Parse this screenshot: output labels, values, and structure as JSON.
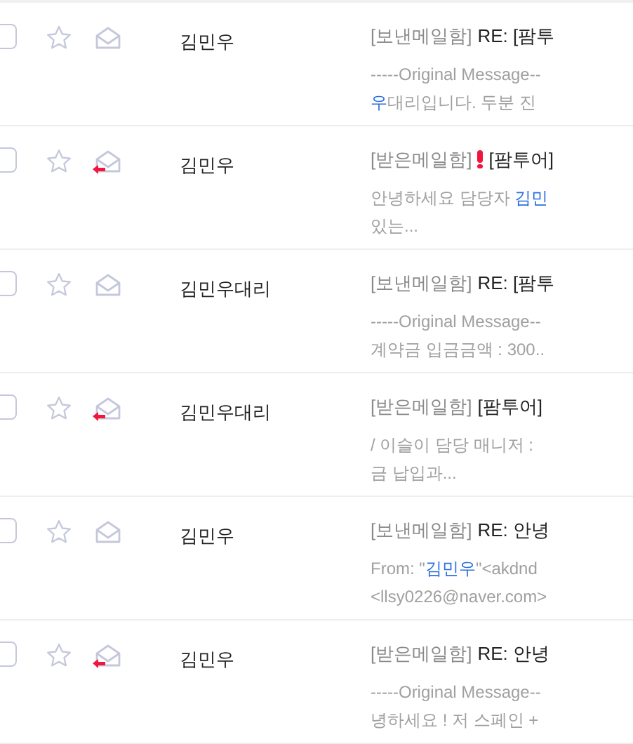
{
  "mails": [
    {
      "checked": false,
      "starred": false,
      "replied": false,
      "sender": "김민우",
      "folder": "[보낸메일함]",
      "important": false,
      "subject": "RE: [팜투",
      "preview": [
        [
          {
            "text": "-----Original Message--",
            "link": false
          }
        ],
        [
          {
            "text": "우",
            "link": true
          },
          {
            "text": "대리입니다. 두분 진",
            "link": false
          }
        ]
      ]
    },
    {
      "checked": false,
      "starred": false,
      "replied": true,
      "sender": "김민우",
      "folder": "[받은메일함]",
      "important": true,
      "subject": "[팜투어]",
      "preview": [
        [
          {
            "text": "안녕하세요 담당자 ",
            "link": false
          },
          {
            "text": "김민",
            "link": true
          }
        ],
        [
          {
            "text": "있는...",
            "link": false
          }
        ]
      ]
    },
    {
      "checked": false,
      "starred": false,
      "replied": false,
      "sender": "김민우대리",
      "folder": "[보낸메일함]",
      "important": false,
      "subject": "RE: [팜투",
      "preview": [
        [
          {
            "text": "-----Original Message--",
            "link": false
          }
        ],
        [
          {
            "text": "계약금 입금금액 : 300..",
            "link": false
          }
        ]
      ]
    },
    {
      "checked": false,
      "starred": false,
      "replied": true,
      "sender": "김민우대리",
      "folder": "[받은메일함]",
      "important": false,
      "subject": "[팜투어]",
      "preview": [
        [
          {
            "text": "/ 이슬이 담당 매니저 :",
            "link": false
          }
        ],
        [
          {
            "text": "금 납입과...",
            "link": false
          }
        ]
      ]
    },
    {
      "checked": false,
      "starred": false,
      "replied": false,
      "sender": "김민우",
      "folder": "[보낸메일함]",
      "important": false,
      "subject": "RE: 안녕",
      "preview": [
        [
          {
            "text": "From: \"",
            "link": false
          },
          {
            "text": "김민우",
            "link": true
          },
          {
            "text": "\"<akdnd",
            "link": false
          }
        ],
        [
          {
            "text": "<llsy0226@naver.com>",
            "link": false
          }
        ]
      ]
    },
    {
      "checked": false,
      "starred": false,
      "replied": true,
      "sender": "김민우",
      "folder": "[받은메일함]",
      "important": false,
      "subject": "RE: 안녕",
      "preview": [
        [
          {
            "text": "-----Original Message--",
            "link": false
          }
        ],
        [
          {
            "text": "녕하세요 ! 저 스페인 +",
            "link": false
          }
        ]
      ]
    }
  ]
}
